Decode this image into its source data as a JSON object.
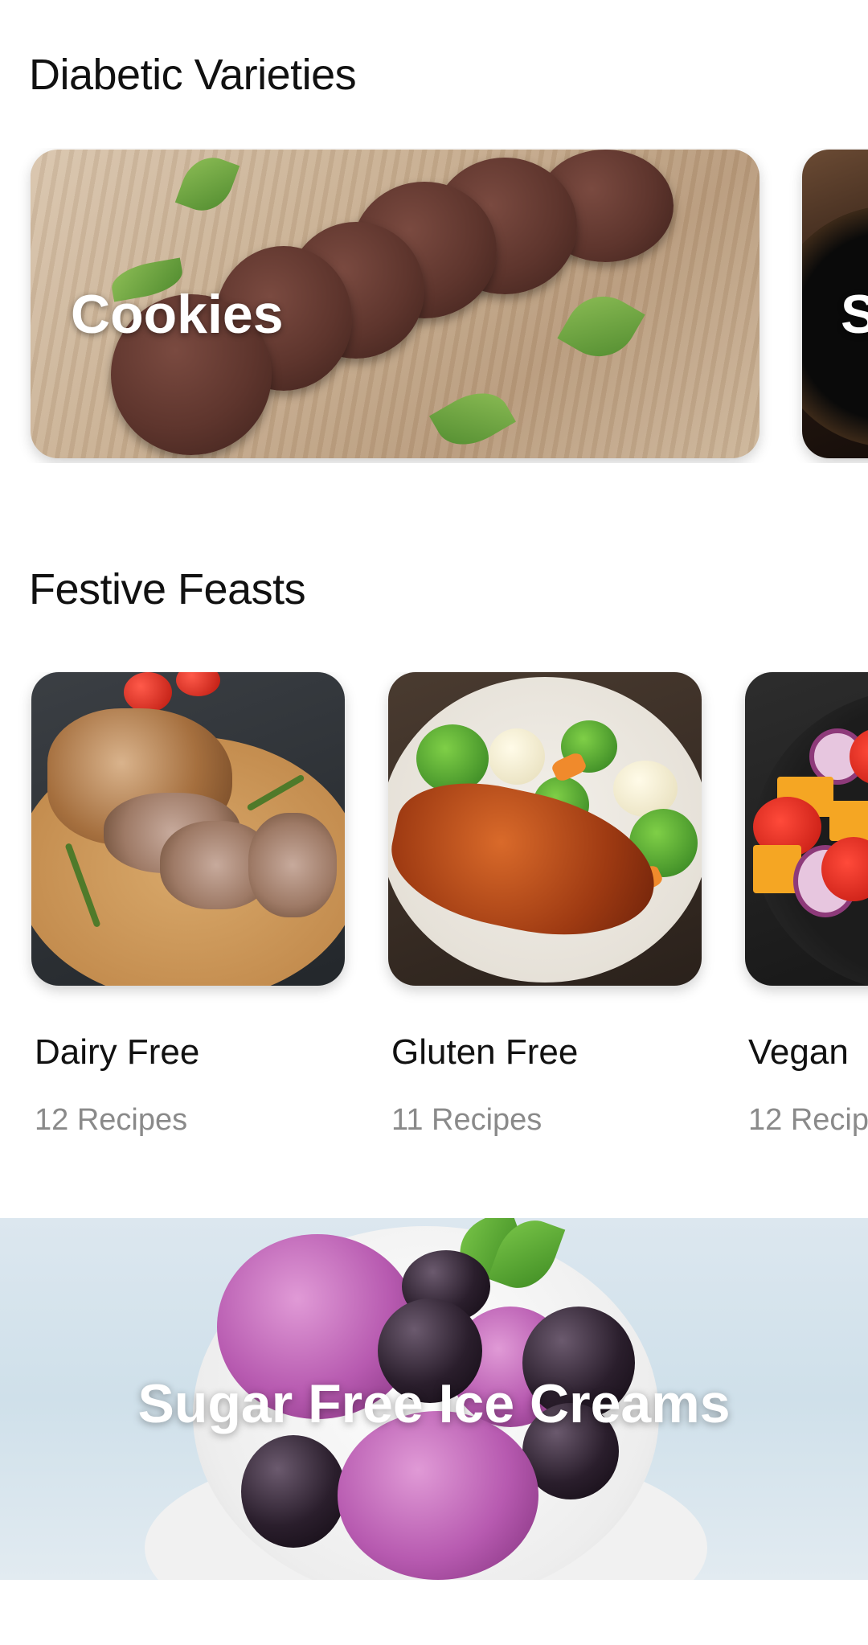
{
  "sections": {
    "diabetic": {
      "title": "Diabetic Varieties",
      "cards": [
        {
          "title": "Cookies"
        },
        {
          "title": "S"
        }
      ]
    },
    "festive": {
      "title": "Festive Feasts",
      "cards": [
        {
          "name": "Dairy Free",
          "count": "12 Recipes"
        },
        {
          "name": "Gluten Free",
          "count": "11 Recipes"
        },
        {
          "name": "Vegan",
          "count": "12 Recip"
        }
      ]
    }
  },
  "banner": {
    "title": "Sugar Free Ice Creams"
  }
}
